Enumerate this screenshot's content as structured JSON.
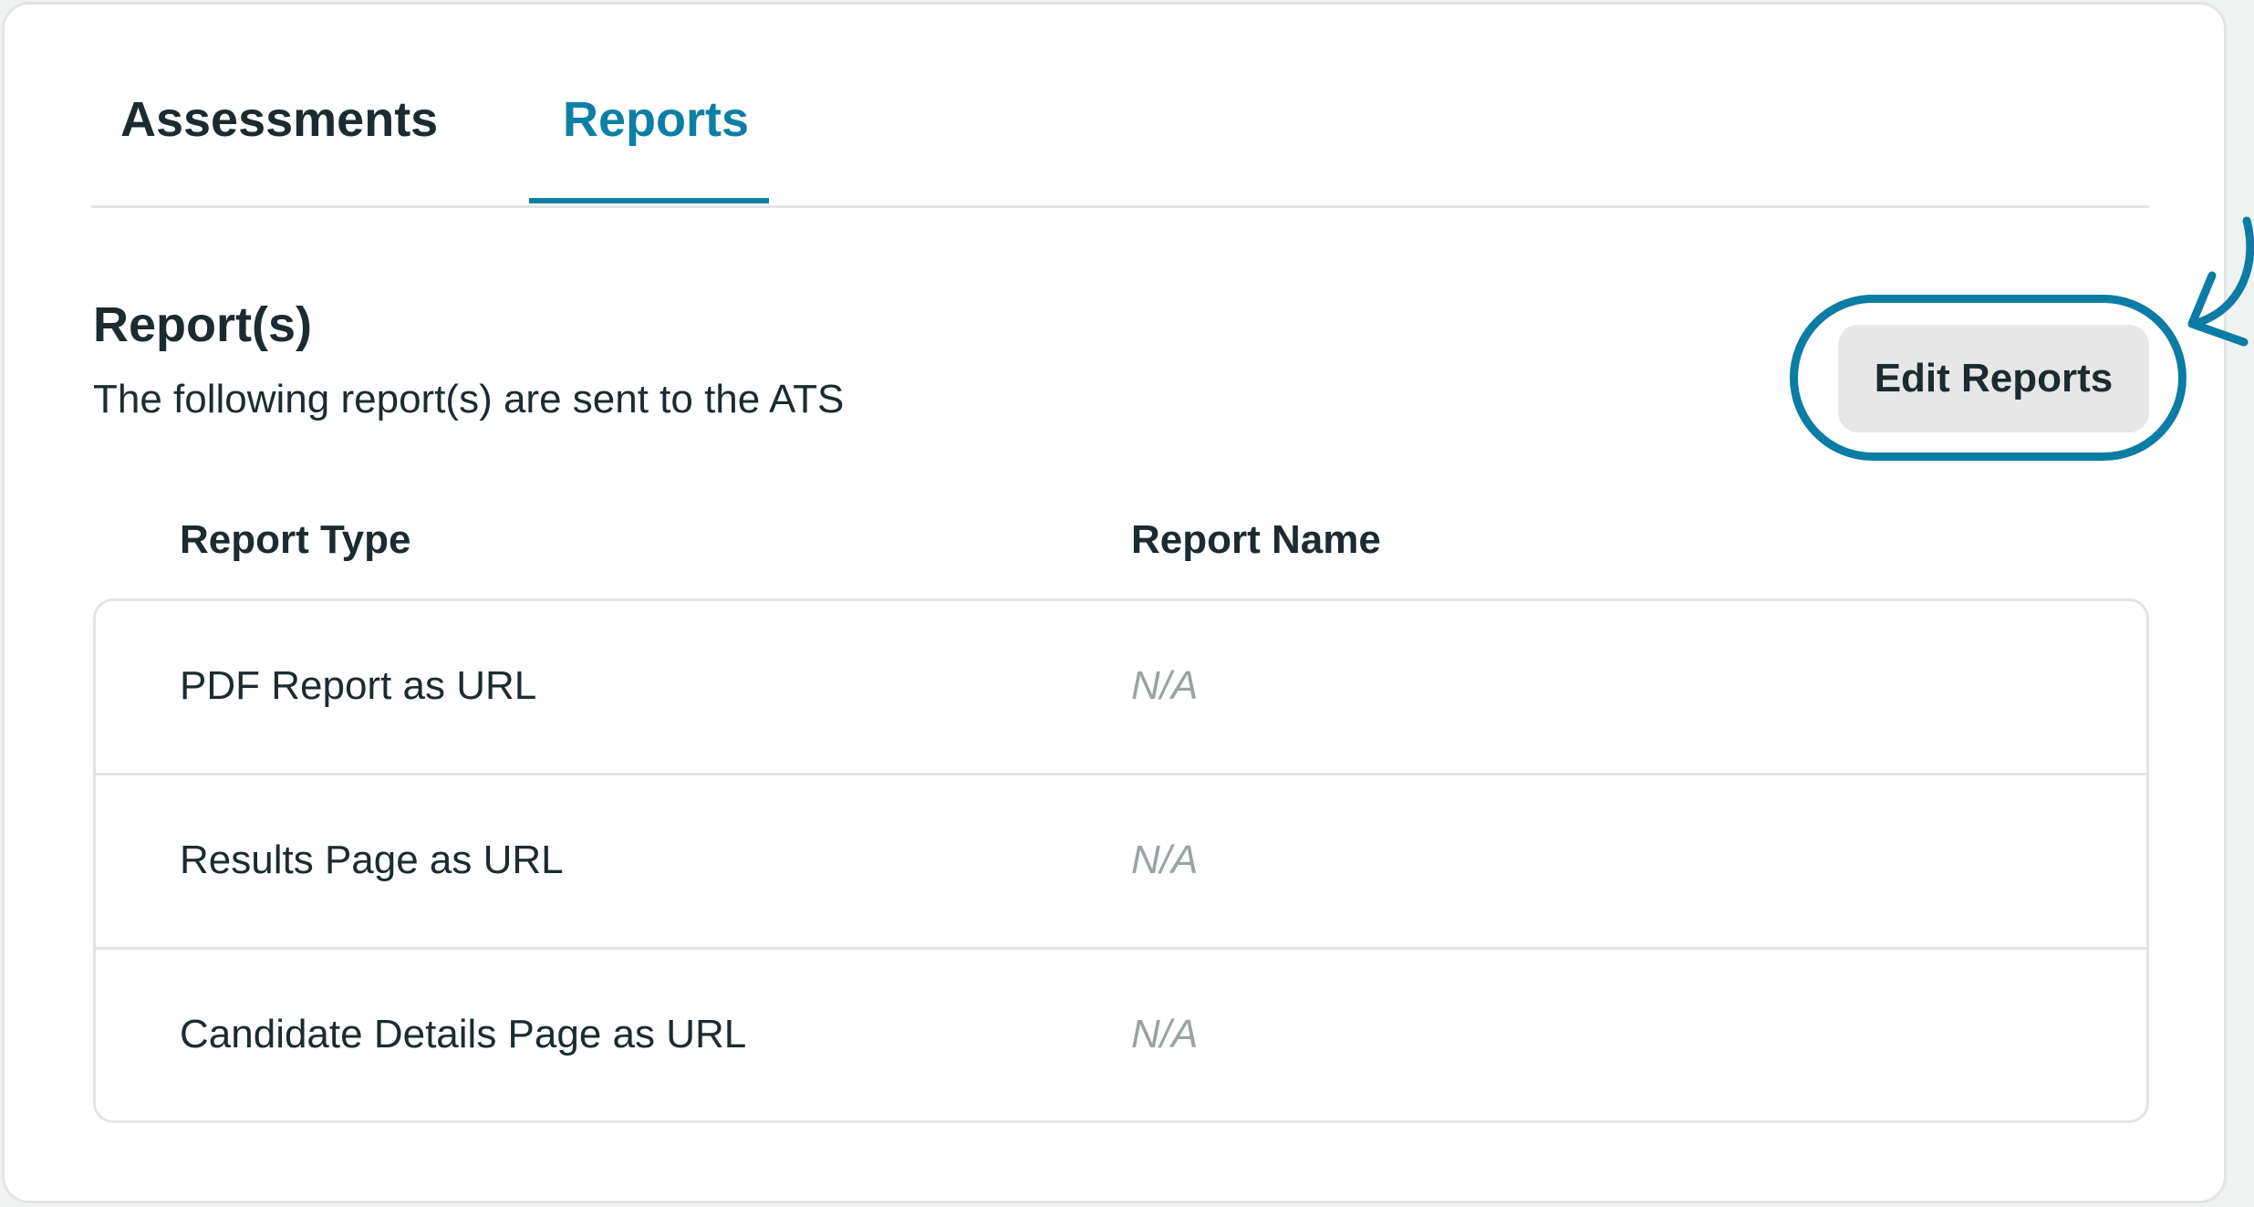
{
  "tabs": [
    {
      "label": "Assessments",
      "active": false
    },
    {
      "label": "Reports",
      "active": true
    }
  ],
  "section": {
    "title": "Report(s)",
    "subtitle": "The following report(s) are sent to the ATS"
  },
  "edit_button": {
    "label": "Edit Reports"
  },
  "table": {
    "headers": {
      "type": "Report Type",
      "name": "Report Name"
    },
    "rows": [
      {
        "type": "PDF Report as URL",
        "name": "N/A"
      },
      {
        "type": "Results Page as URL",
        "name": "N/A"
      },
      {
        "type": "Candidate Details Page as URL",
        "name": "N/A"
      }
    ]
  },
  "colors": {
    "accent": "#0d7fa5",
    "text": "#1c2b2f",
    "muted": "#9aa2a4",
    "border": "#e3e5e5",
    "button_bg": "#e6e7e6"
  },
  "icons": {
    "annotation_arrow": "curved-arrow-icon",
    "highlight": "highlight-circle"
  }
}
